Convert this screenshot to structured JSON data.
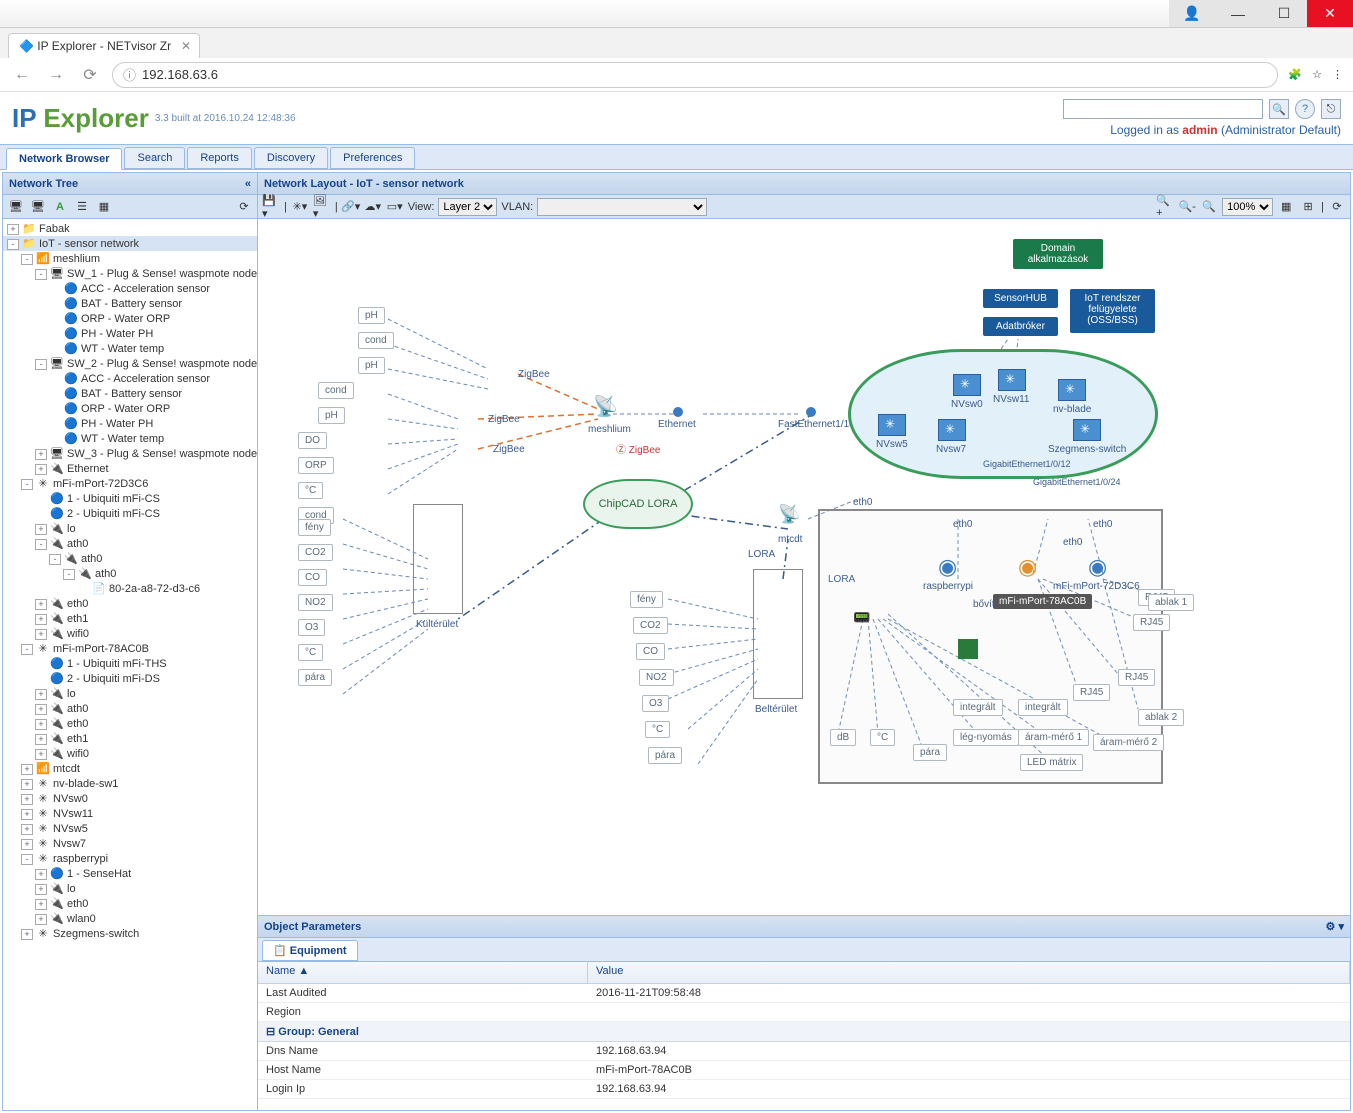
{
  "window": {
    "tab_title": "IP Explorer - NETvisor Zr",
    "url": "192.168.63.6"
  },
  "app": {
    "logo_ip": "IP",
    "logo_ex": "Explorer",
    "build": "3.3 built at 2016.10.24 12:48:36",
    "logged_in_prefix": "Logged in as ",
    "logged_in_user": "admin",
    "logged_in_role": " (Administrator Default)"
  },
  "maintabs": [
    "Network Browser",
    "Search",
    "Reports",
    "Discovery",
    "Preferences"
  ],
  "left": {
    "title": "Network Tree",
    "nodes": [
      {
        "d": 0,
        "t": "+",
        "i": "📁",
        "l": "Fabak"
      },
      {
        "d": 0,
        "t": "-",
        "i": "📁",
        "l": "IoT - sensor network",
        "sel": true
      },
      {
        "d": 1,
        "t": "-",
        "i": "📶",
        "l": "meshlium"
      },
      {
        "d": 2,
        "t": "-",
        "i": "🖥",
        "l": "SW_1 - Plug & Sense! waspmote node"
      },
      {
        "d": 3,
        "t": "",
        "i": "🔵",
        "l": "ACC - Acceleration sensor"
      },
      {
        "d": 3,
        "t": "",
        "i": "🔵",
        "l": "BAT - Battery sensor"
      },
      {
        "d": 3,
        "t": "",
        "i": "🔵",
        "l": "ORP - Water ORP"
      },
      {
        "d": 3,
        "t": "",
        "i": "🔵",
        "l": "PH - Water PH"
      },
      {
        "d": 3,
        "t": "",
        "i": "🔵",
        "l": "WT - Water temp"
      },
      {
        "d": 2,
        "t": "-",
        "i": "🖥",
        "l": "SW_2 - Plug & Sense! waspmote node"
      },
      {
        "d": 3,
        "t": "",
        "i": "🔵",
        "l": "ACC - Acceleration sensor"
      },
      {
        "d": 3,
        "t": "",
        "i": "🔵",
        "l": "BAT - Battery sensor"
      },
      {
        "d": 3,
        "t": "",
        "i": "🔵",
        "l": "ORP - Water ORP"
      },
      {
        "d": 3,
        "t": "",
        "i": "🔵",
        "l": "PH - Water PH"
      },
      {
        "d": 3,
        "t": "",
        "i": "🔵",
        "l": "WT - Water temp"
      },
      {
        "d": 2,
        "t": "+",
        "i": "🖥",
        "l": "SW_3 - Plug & Sense! waspmote node"
      },
      {
        "d": 2,
        "t": "+",
        "i": "🔌",
        "l": "Ethernet"
      },
      {
        "d": 1,
        "t": "-",
        "i": "✳",
        "l": "mFi-mPort-72D3C6"
      },
      {
        "d": 2,
        "t": "",
        "i": "🔵",
        "l": "1 - Ubiquiti mFi-CS"
      },
      {
        "d": 2,
        "t": "",
        "i": "🔵",
        "l": "2 - Ubiquiti mFi-CS"
      },
      {
        "d": 2,
        "t": "+",
        "i": "🔌",
        "l": "lo"
      },
      {
        "d": 2,
        "t": "-",
        "i": "🔌",
        "l": "ath0"
      },
      {
        "d": 3,
        "t": "-",
        "i": "🔌",
        "l": "ath0"
      },
      {
        "d": 4,
        "t": "-",
        "i": "🔌",
        "l": "ath0"
      },
      {
        "d": 5,
        "t": "",
        "i": "📄",
        "l": "80-2a-a8-72-d3-c6"
      },
      {
        "d": 2,
        "t": "+",
        "i": "🔌",
        "l": "eth0"
      },
      {
        "d": 2,
        "t": "+",
        "i": "🔌",
        "l": "eth1"
      },
      {
        "d": 2,
        "t": "+",
        "i": "🔌",
        "l": "wifi0"
      },
      {
        "d": 1,
        "t": "-",
        "i": "✳",
        "l": "mFi-mPort-78AC0B"
      },
      {
        "d": 2,
        "t": "",
        "i": "🔵",
        "l": "1 - Ubiquiti mFi-THS"
      },
      {
        "d": 2,
        "t": "",
        "i": "🔵",
        "l": "2 - Ubiquiti mFi-DS"
      },
      {
        "d": 2,
        "t": "+",
        "i": "🔌",
        "l": "lo"
      },
      {
        "d": 2,
        "t": "+",
        "i": "🔌",
        "l": "ath0"
      },
      {
        "d": 2,
        "t": "+",
        "i": "🔌",
        "l": "eth0"
      },
      {
        "d": 2,
        "t": "+",
        "i": "🔌",
        "l": "eth1"
      },
      {
        "d": 2,
        "t": "+",
        "i": "🔌",
        "l": "wifi0"
      },
      {
        "d": 1,
        "t": "+",
        "i": "📶",
        "l": "mtcdt"
      },
      {
        "d": 1,
        "t": "+",
        "i": "✳",
        "l": "nv-blade-sw1"
      },
      {
        "d": 1,
        "t": "+",
        "i": "✳",
        "l": "NVsw0"
      },
      {
        "d": 1,
        "t": "+",
        "i": "✳",
        "l": "NVsw11"
      },
      {
        "d": 1,
        "t": "+",
        "i": "✳",
        "l": "NVsw5"
      },
      {
        "d": 1,
        "t": "+",
        "i": "✳",
        "l": "Nvsw7"
      },
      {
        "d": 1,
        "t": "-",
        "i": "✳",
        "l": "raspberrypi"
      },
      {
        "d": 2,
        "t": "+",
        "i": "🔵",
        "l": "1 - SenseHat"
      },
      {
        "d": 2,
        "t": "+",
        "i": "🔌",
        "l": "lo"
      },
      {
        "d": 2,
        "t": "+",
        "i": "🔌",
        "l": "eth0"
      },
      {
        "d": 2,
        "t": "+",
        "i": "🔌",
        "l": "wlan0"
      },
      {
        "d": 1,
        "t": "+",
        "i": "✳",
        "l": "Szegmens-switch"
      }
    ]
  },
  "layout": {
    "title": "Network Layout - IoT - sensor network",
    "view_label": "View:",
    "view_value": "Layer 2",
    "vlan_label": "VLAN:",
    "zoom": "100%",
    "blocks": {
      "domain": "Domain alkalmazások",
      "sensorhub": "SensorHUB",
      "adatbroker": "Adatbróker",
      "iot_oss": "IoT rendszer felügyelete (OSS/BSS)"
    },
    "switches": [
      "NVsw0",
      "NVsw11",
      "nv-blade",
      "NVsw5",
      "Nvsw7",
      "Szegmens-switch"
    ],
    "sensors_left": [
      "pH",
      "cond",
      "pH",
      "cond",
      "pH",
      "DO",
      "ORP",
      "°C",
      "cond",
      "fény",
      "CO2",
      "CO",
      "NO2",
      "O3",
      "°C",
      "pára"
    ],
    "sensors_mid": [
      "fény",
      "CO2",
      "CO",
      "NO2",
      "O3",
      "°C",
      "pára"
    ],
    "sensors_right": [
      "dB",
      "°C",
      "pára",
      "lég-nyomás",
      "áram-mérő 1",
      "áram-mérő 2",
      "LED mátrix",
      "integrált",
      "integrált",
      "RJ45",
      "RJ45",
      "RJ45",
      "RJ45",
      "ablak 1",
      "ablak 2"
    ],
    "labels": {
      "zigbee": "ZigBee",
      "meshlium": "meshlium",
      "ethernet": "Ethernet",
      "fast_eth": "FastEthernet1/14",
      "gig1": "GigabitEthernet1/0/12",
      "gig2": "GigabitEthernet1/0/24",
      "eth0": "eth0",
      "chipcad": "ChipCAD LORA",
      "lora": "LORA",
      "kulterulet": "Kültérület",
      "belterulet": "Beltérület",
      "mtcdt": "mtcdt",
      "raspberrypi": "raspberrypi",
      "bovito": "bővítő",
      "mfi72": "mFi-mPort-72D3C6",
      "mfi78": "mFi-mPort-78AC0B"
    }
  },
  "params": {
    "title": "Object Parameters",
    "tab": "Equipment",
    "cols": [
      "Name ▲",
      "Value"
    ],
    "rows": [
      {
        "n": "Last Audited",
        "v": "2016-11-21T09:58:48"
      },
      {
        "n": "Region",
        "v": ""
      }
    ],
    "group": "Group: General",
    "grows": [
      {
        "n": "Dns Name",
        "v": "192.168.63.94"
      },
      {
        "n": "Host Name",
        "v": "mFi-mPort-78AC0B"
      },
      {
        "n": "Login Ip",
        "v": "192.168.63.94"
      }
    ]
  }
}
